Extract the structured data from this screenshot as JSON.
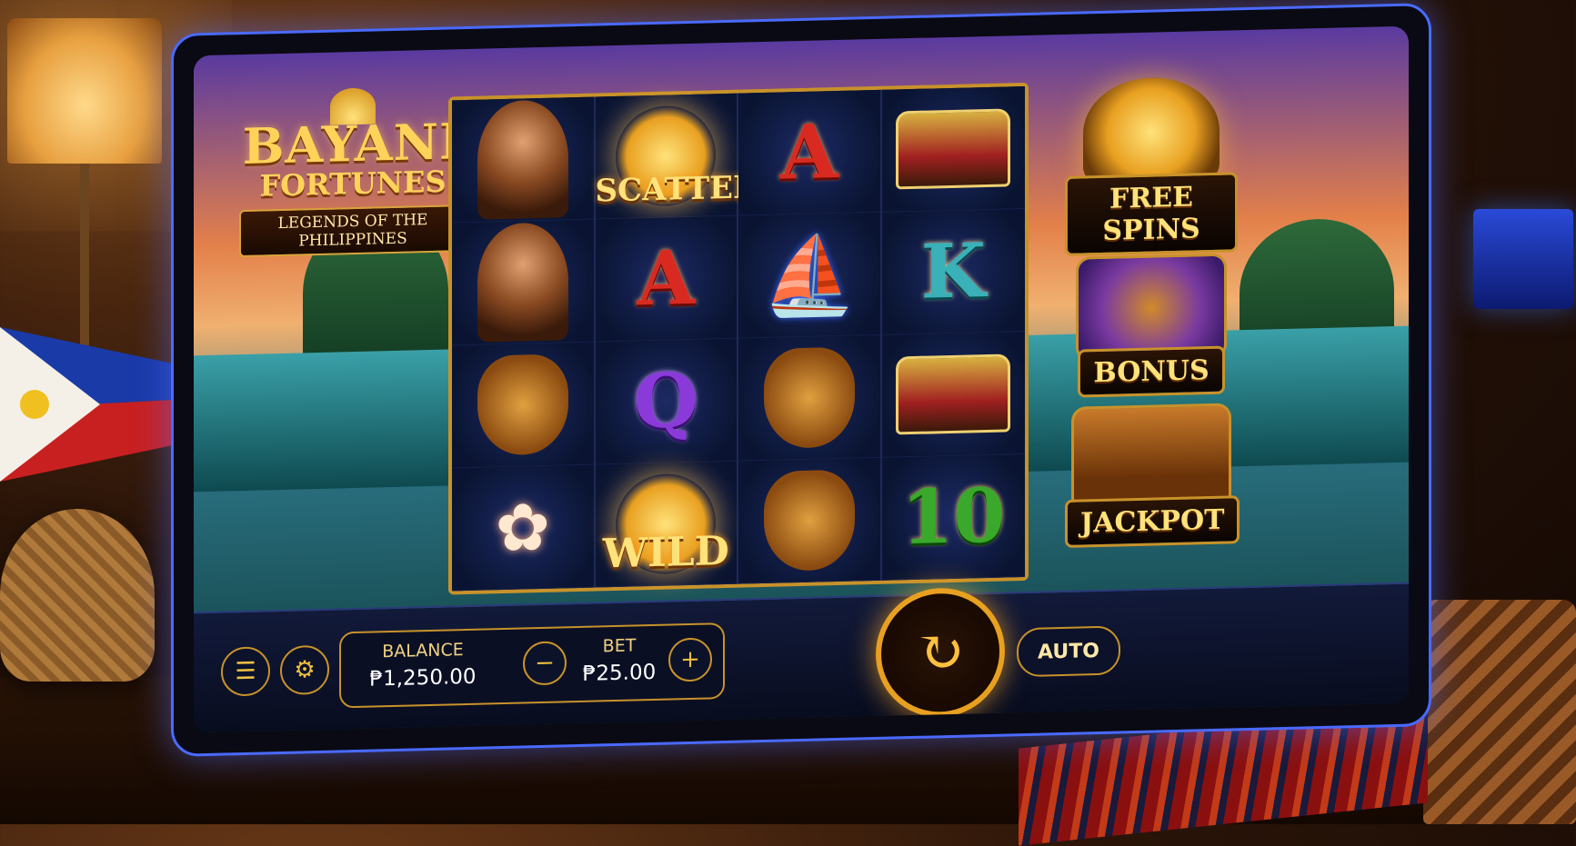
{
  "game": {
    "title_line1": "BAYANI",
    "title_line2": "FORTUNES",
    "tagline": "LEGENDS OF THE PHILIPPINES"
  },
  "reels": [
    [
      {
        "kind": "portrait",
        "name": "filipina-heroine-icon"
      },
      {
        "kind": "portrait",
        "name": "warrior-red-headband-icon"
      },
      {
        "kind": "mask",
        "name": "golden-warrior-icon"
      },
      {
        "kind": "flower",
        "name": "sampaguita-flower-icon",
        "glyph": "✿"
      }
    ],
    [
      {
        "kind": "scatter",
        "name": "sun-scatter-icon",
        "label": "SCATTER"
      },
      {
        "kind": "letter",
        "name": "letter-a-icon",
        "text": "A",
        "cls": "sym-a"
      },
      {
        "kind": "letter",
        "name": "letter-q-icon",
        "text": "Q",
        "cls": "sym-q"
      },
      {
        "kind": "wild",
        "name": "sun-wild-icon",
        "label": "WILD"
      }
    ],
    [
      {
        "kind": "letter",
        "name": "letter-a-icon",
        "text": "A",
        "cls": "sym-a"
      },
      {
        "kind": "boat",
        "name": "vinta-boat-icon",
        "glyph": "⛵"
      },
      {
        "kind": "mask",
        "name": "warrior-helmet-icon"
      },
      {
        "kind": "mask",
        "name": "masked-warrior-icon"
      }
    ],
    [
      {
        "kind": "vehicle",
        "name": "jeepney-red-icon"
      },
      {
        "kind": "letter",
        "name": "letter-k-icon",
        "text": "K",
        "cls": "sym-k"
      },
      {
        "kind": "vehicle",
        "name": "jeepney-gold-icon"
      },
      {
        "kind": "letter",
        "name": "number-10-icon",
        "text": "10",
        "cls": "sym-10"
      }
    ]
  ],
  "features": {
    "free_spins": "FREE SPINS",
    "bonus": "BONUS",
    "jackpot": "JACKPOT"
  },
  "controls": {
    "menu_icon": "☰",
    "settings_icon": "⚙",
    "balance_label": "BALANCE",
    "balance_value": "₱1,250.00",
    "bet_label": "BET",
    "bet_value": "₱25.00",
    "bet_minus": "−",
    "bet_plus": "+",
    "spin_icon": "↻",
    "auto_label": "AUTO"
  },
  "colors": {
    "gold": "#ffd35a",
    "frame": "#c8922a",
    "neon": "#4a6aff"
  }
}
